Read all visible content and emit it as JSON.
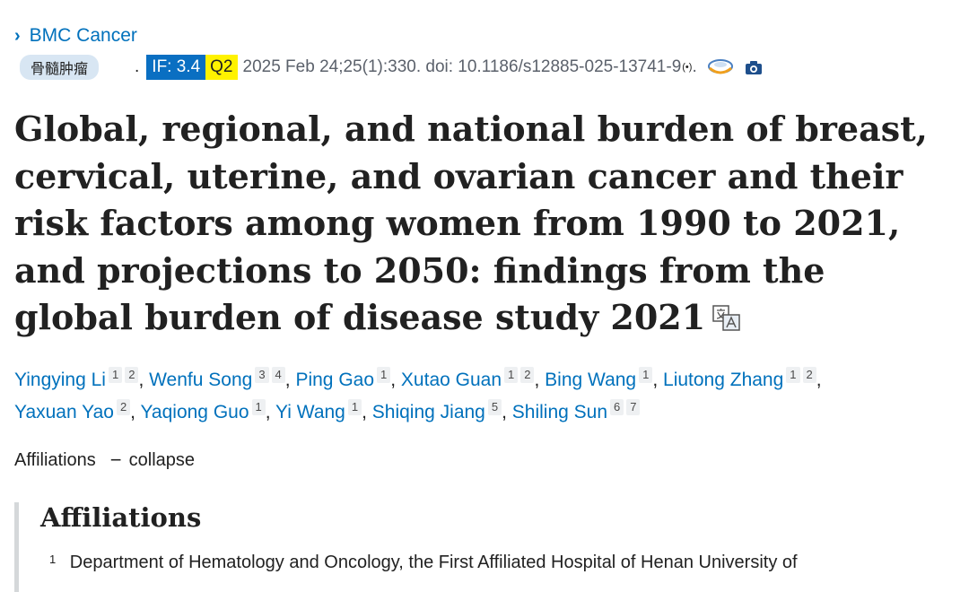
{
  "journal": {
    "chevron": "›",
    "name": "BMC Cancer"
  },
  "meta": {
    "tag": "骨髓肿瘤",
    "separator": ".",
    "impact_factor": "IF: 3.4",
    "quartile": "Q2",
    "citation": "2025 Feb 24;25(1):330. doi: 10.1186/s12885-025-13741-9",
    "radio_symbol": "(•)",
    "trailing_dot": "."
  },
  "article": {
    "title": "Global, regional, and national burden of breast, cervical, uterine, and ovarian cancer and their risk factors among women from 1990 to 2021, and projections to 2050: findings from the global burden of disease study 2021"
  },
  "authors": [
    {
      "name": "Yingying Li",
      "affs": [
        "1",
        "2"
      ]
    },
    {
      "name": "Wenfu Song",
      "affs": [
        "3",
        "4"
      ]
    },
    {
      "name": "Ping Gao",
      "affs": [
        "1"
      ]
    },
    {
      "name": "Xutao Guan",
      "affs": [
        "1",
        "2"
      ]
    },
    {
      "name": "Bing Wang",
      "affs": [
        "1"
      ]
    },
    {
      "name": "Liutong Zhang",
      "affs": [
        "1",
        "2"
      ]
    },
    {
      "name": "Yaxuan Yao",
      "affs": [
        "2"
      ]
    },
    {
      "name": "Yaqiong Guo",
      "affs": [
        "1"
      ]
    },
    {
      "name": "Yi Wang",
      "affs": [
        "1"
      ]
    },
    {
      "name": "Shiqing Jiang",
      "affs": [
        "5"
      ]
    },
    {
      "name": "Shiling Sun",
      "affs": [
        "6",
        "7"
      ]
    }
  ],
  "affiliations_toggle": {
    "label": "Affiliations",
    "dash": "−",
    "action": "collapse"
  },
  "affiliations": {
    "heading": "Affiliations",
    "items": [
      {
        "num": "1",
        "text": "Department of Hematology and Oncology, the First Affiliated Hospital of Henan University of"
      }
    ]
  },
  "colors": {
    "link": "#0071bc",
    "if_badge": "#0a6fc2",
    "quartile_badge": "#fff200",
    "tag_badge": "#d8e6f3"
  },
  "icons": [
    "chevron-right-icon",
    "radio-broadcast-icon",
    "cloud-icon",
    "camera-icon",
    "translate-icon"
  ]
}
